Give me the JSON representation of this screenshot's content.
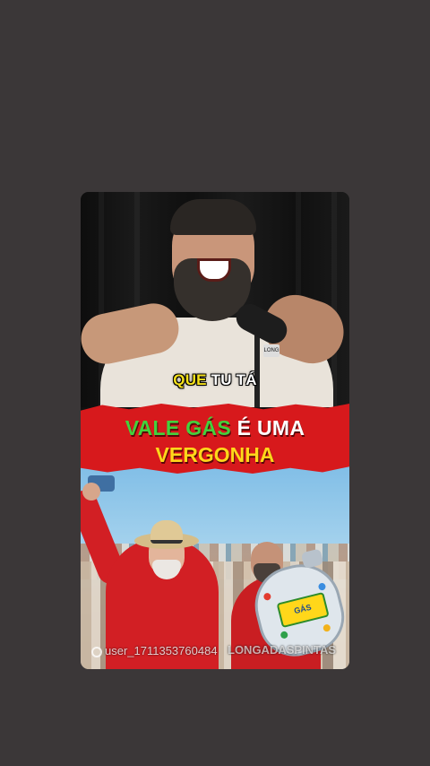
{
  "subtitle": {
    "word1": "QUE",
    "word2": "TU TÁ"
  },
  "banner": {
    "line1_green": "VALE GÁS",
    "line1_rest": " É UMA",
    "line2": "VERGONHA"
  },
  "watermark": {
    "user": "user_1711353760484",
    "handle": "LONGADASPINTAS"
  },
  "mic_logo": "LONG",
  "gas_label": "GÁS",
  "colors": {
    "page_background": "#3b3738",
    "banner_red": "#d7191c",
    "banner_green": "#43d13d",
    "banner_yellow": "#ffd71a",
    "subtitle_yellow": "#f6e21b"
  }
}
